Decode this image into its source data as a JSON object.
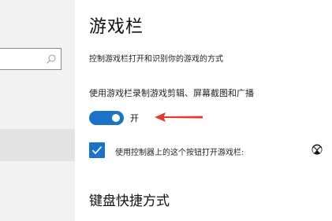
{
  "header": {
    "title": "游戏栏"
  },
  "main": {
    "description": "控制游戏栏打开和识别你的游戏的方式",
    "record_label": "使用游戏栏录制游戏剪辑、屏幕截图和广播",
    "toggle_state": "开",
    "controller_checkbox_label": "使用控制器上的这个按钮打开游戏栏:",
    "keyboard_section_title": "键盘快捷方式"
  },
  "icons": {
    "search": "search-icon",
    "xbox": "xbox-icon",
    "arrow": "red-arrow-icon",
    "check": "checkmark-icon"
  },
  "colors": {
    "accent": "#1a73c7",
    "annotation_arrow": "#e53935",
    "nav_background": "#f2f2f2",
    "nav_selected": "#e3e3e3"
  },
  "state": {
    "record_toggle_on": true,
    "controller_checkbox_checked": true
  }
}
